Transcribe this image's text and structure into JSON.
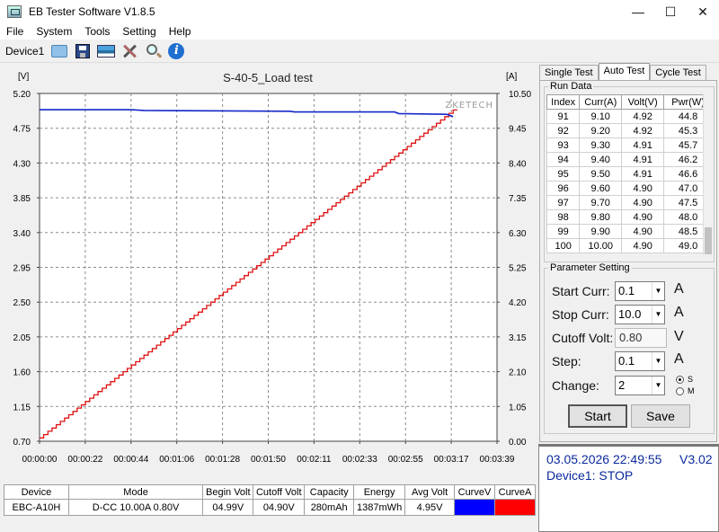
{
  "window": {
    "title": "EB Tester Software V1.8.5"
  },
  "menu": [
    "File",
    "System",
    "Tools",
    "Setting",
    "Help"
  ],
  "toolbar": {
    "device_label": "Device1",
    "icons": [
      "folder-open-icon",
      "save-icon",
      "chart-icon",
      "tools-icon",
      "search-icon",
      "info-icon"
    ]
  },
  "chart_data": {
    "type": "line",
    "title": "S-40-5_Load test",
    "watermark": "ZKETECH",
    "ylabel_left": "[V]",
    "ylabel_right": "[A]",
    "ylim_left": [
      0.7,
      5.2
    ],
    "ylim_right": [
      0.0,
      10.5
    ],
    "yticks_left": [
      "5.20",
      "4.75",
      "4.30",
      "3.85",
      "3.40",
      "2.95",
      "2.50",
      "2.05",
      "1.60",
      "1.15",
      "0.70"
    ],
    "yticks_right": [
      "10.50",
      "9.45",
      "8.40",
      "7.35",
      "6.30",
      "5.25",
      "4.20",
      "3.15",
      "2.10",
      "1.05",
      "0.00"
    ],
    "xticks": [
      "00:00:00",
      "00:00:22",
      "00:00:44",
      "00:01:06",
      "00:01:28",
      "00:01:50",
      "00:02:11",
      "00:02:33",
      "00:02:55",
      "00:03:17",
      "00:03:39"
    ],
    "xlim_seconds": [
      0,
      219
    ],
    "grid": true,
    "series": [
      {
        "axis": "left",
        "color": "#1428c8",
        "x": [
          0,
          44,
          50,
          120,
          122,
          170,
          172,
          195,
          198
        ],
        "y": [
          4.99,
          4.99,
          4.98,
          4.97,
          4.96,
          4.96,
          4.94,
          4.93,
          4.9
        ]
      },
      {
        "axis": "right",
        "color": "#e01010",
        "step": true,
        "x_start": 0,
        "x_step": 2,
        "current_start": 0.1,
        "current_step": 0.1,
        "count": 100
      }
    ]
  },
  "info_table": {
    "headers": [
      "Device",
      "Mode",
      "Begin Volt",
      "Cutoff Volt",
      "Capacity",
      "Energy",
      "Avg Volt",
      "CurveV",
      "CurveA"
    ],
    "row": [
      "EBC-A10H",
      "D-CC  10.00A  0.80V",
      "04.99V",
      "04.90V",
      "280mAh",
      "1387mWh",
      "4.95V"
    ],
    "curve_colors": [
      "#0000ff",
      "#ff0000"
    ]
  },
  "tabs": [
    "Single Test",
    "Auto Test",
    "Cycle Test"
  ],
  "run_data": {
    "title": "Run Data",
    "headers": [
      "Index",
      "Curr(A)",
      "Volt(V)",
      "Pwr(W)"
    ],
    "rows": [
      [
        "91",
        "9.10",
        "4.92",
        "44.8"
      ],
      [
        "92",
        "9.20",
        "4.92",
        "45.3"
      ],
      [
        "93",
        "9.30",
        "4.91",
        "45.7"
      ],
      [
        "94",
        "9.40",
        "4.91",
        "46.2"
      ],
      [
        "95",
        "9.50",
        "4.91",
        "46.6"
      ],
      [
        "96",
        "9.60",
        "4.90",
        "47.0"
      ],
      [
        "97",
        "9.70",
        "4.90",
        "47.5"
      ],
      [
        "98",
        "9.80",
        "4.90",
        "48.0"
      ],
      [
        "99",
        "9.90",
        "4.90",
        "48.5"
      ],
      [
        "100",
        "10.00",
        "4.90",
        "49.0"
      ]
    ]
  },
  "params": {
    "title": "Parameter Setting",
    "start_curr_label": "Start Curr:",
    "start_curr": "0.1",
    "stop_curr_label": "Stop Curr:",
    "stop_curr": "10.0",
    "cutoff_volt_label": "Cutoff Volt:",
    "cutoff_volt": "0.80",
    "step_label": "Step:",
    "step": "0.1",
    "change_label": "Change:",
    "change": "2",
    "unit_a": "A",
    "unit_v": "V",
    "radio_s": "S",
    "radio_m": "M",
    "start_btn": "Start",
    "save_btn": "Save"
  },
  "status": {
    "datetime": "03.05.2026 22:49:55",
    "version": "V3.02",
    "device_state": "Device1: STOP"
  }
}
